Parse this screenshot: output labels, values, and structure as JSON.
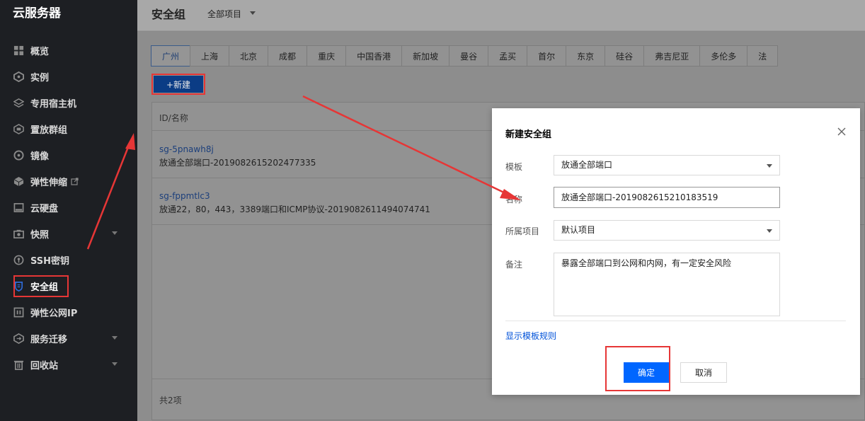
{
  "sidebar": {
    "brand": "云服务器",
    "items": [
      {
        "label": "概览",
        "icon": "grid-icon"
      },
      {
        "label": "实例",
        "icon": "instance-icon"
      },
      {
        "label": "专用宿主机",
        "icon": "layers-icon"
      },
      {
        "label": "置放群组",
        "icon": "group-icon"
      },
      {
        "label": "镜像",
        "icon": "disc-icon"
      },
      {
        "label": "弹性伸缩",
        "icon": "cube-icon"
      },
      {
        "label": "云硬盘",
        "icon": "disk-icon"
      },
      {
        "label": "快照",
        "icon": "camera-icon"
      },
      {
        "label": "SSH密钥",
        "icon": "key-icon"
      },
      {
        "label": "安全组",
        "icon": "shield-icon"
      },
      {
        "label": "弹性公网IP",
        "icon": "ip-icon"
      },
      {
        "label": "服务迁移",
        "icon": "migrate-icon"
      },
      {
        "label": "回收站",
        "icon": "trash-icon"
      }
    ]
  },
  "header": {
    "title": "安全组",
    "project": "全部项目"
  },
  "regions": [
    "广州",
    "上海",
    "北京",
    "成都",
    "重庆",
    "中国香港",
    "新加坡",
    "曼谷",
    "孟买",
    "首尔",
    "东京",
    "硅谷",
    "弗吉尼亚",
    "多伦多",
    "法"
  ],
  "toolbar": {
    "new_label": "+新建"
  },
  "table": {
    "header": "ID/名称",
    "rows": [
      {
        "id": "sg-5pnawh8j",
        "name": "放通全部端口-2019082615202477335"
      },
      {
        "id": "sg-fppmtlc3",
        "name": "放通22，80，443，3389端口和ICMP协议-2019082611494074741"
      }
    ],
    "footer": "共2项"
  },
  "dialog": {
    "title": "新建安全组",
    "template_label": "模板",
    "template_value": "放通全部端口",
    "name_label": "名称",
    "name_value": "放通全部端口-2019082615210183519",
    "project_label": "所属项目",
    "project_value": "默认项目",
    "remark_label": "备注",
    "remark_value": "暴露全部端口到公网和内网，有一定安全风险",
    "show_rules_link": "显示模板规则",
    "confirm_label": "确定",
    "cancel_label": "取消"
  },
  "colors": {
    "sidebar_bg": "#1d1f23",
    "primary": "#0066ff",
    "link": "#0052d9",
    "annotation_red": "#e63636"
  }
}
